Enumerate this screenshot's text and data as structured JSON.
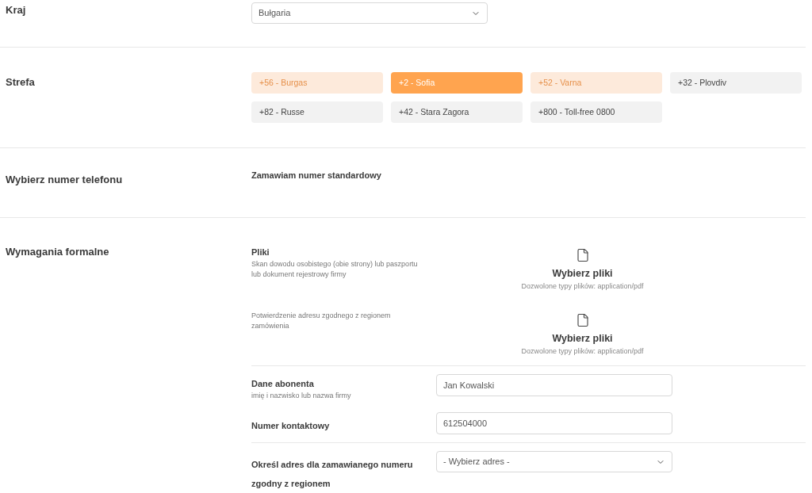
{
  "country": {
    "label": "Kraj",
    "value": "Bułgaria"
  },
  "zone": {
    "label": "Strefa",
    "options": [
      {
        "label": "+56 - Burgas",
        "selected": false,
        "highlighted": true
      },
      {
        "label": "+2 - Sofia",
        "selected": true,
        "highlighted": false
      },
      {
        "label": "+52 - Varna",
        "selected": false,
        "highlighted": true
      },
      {
        "label": "+32 - Plovdiv",
        "selected": false,
        "highlighted": false
      },
      {
        "label": "+82 - Russe",
        "selected": false,
        "highlighted": false
      },
      {
        "label": "+42 - Stara Zagora",
        "selected": false,
        "highlighted": false
      },
      {
        "label": "+800 - Toll-free 0800",
        "selected": false,
        "highlighted": false
      }
    ]
  },
  "phone": {
    "label": "Wybierz numer telefonu",
    "value": "Zamawiam numer standardowy"
  },
  "formal": {
    "label": "Wymagania formalne",
    "files": [
      {
        "title": "Pliki",
        "description": "Skan dowodu osobistego (obie strony) lub paszportu lub dokument rejestrowy firmy",
        "button": "Wybierz pliki",
        "hint": "Dozwolone typy plików: application/pdf"
      },
      {
        "description": "Potwierdzenie adresu zgodnego z regionem zamówienia",
        "button": "Wybierz pliki",
        "hint": "Dozwolone typy plików: application/pdf"
      }
    ],
    "subscriber": {
      "label": "Dane abonenta",
      "hint": "imię i nazwisko lub nazwa firmy",
      "value": "Jan Kowalski"
    },
    "contact": {
      "label": "Numer kontaktowy",
      "value": "612504000"
    },
    "address": {
      "label": "Określ adres dla zamawianego numeru zgodny z regionem",
      "value": "- Wybierz adres -"
    }
  }
}
